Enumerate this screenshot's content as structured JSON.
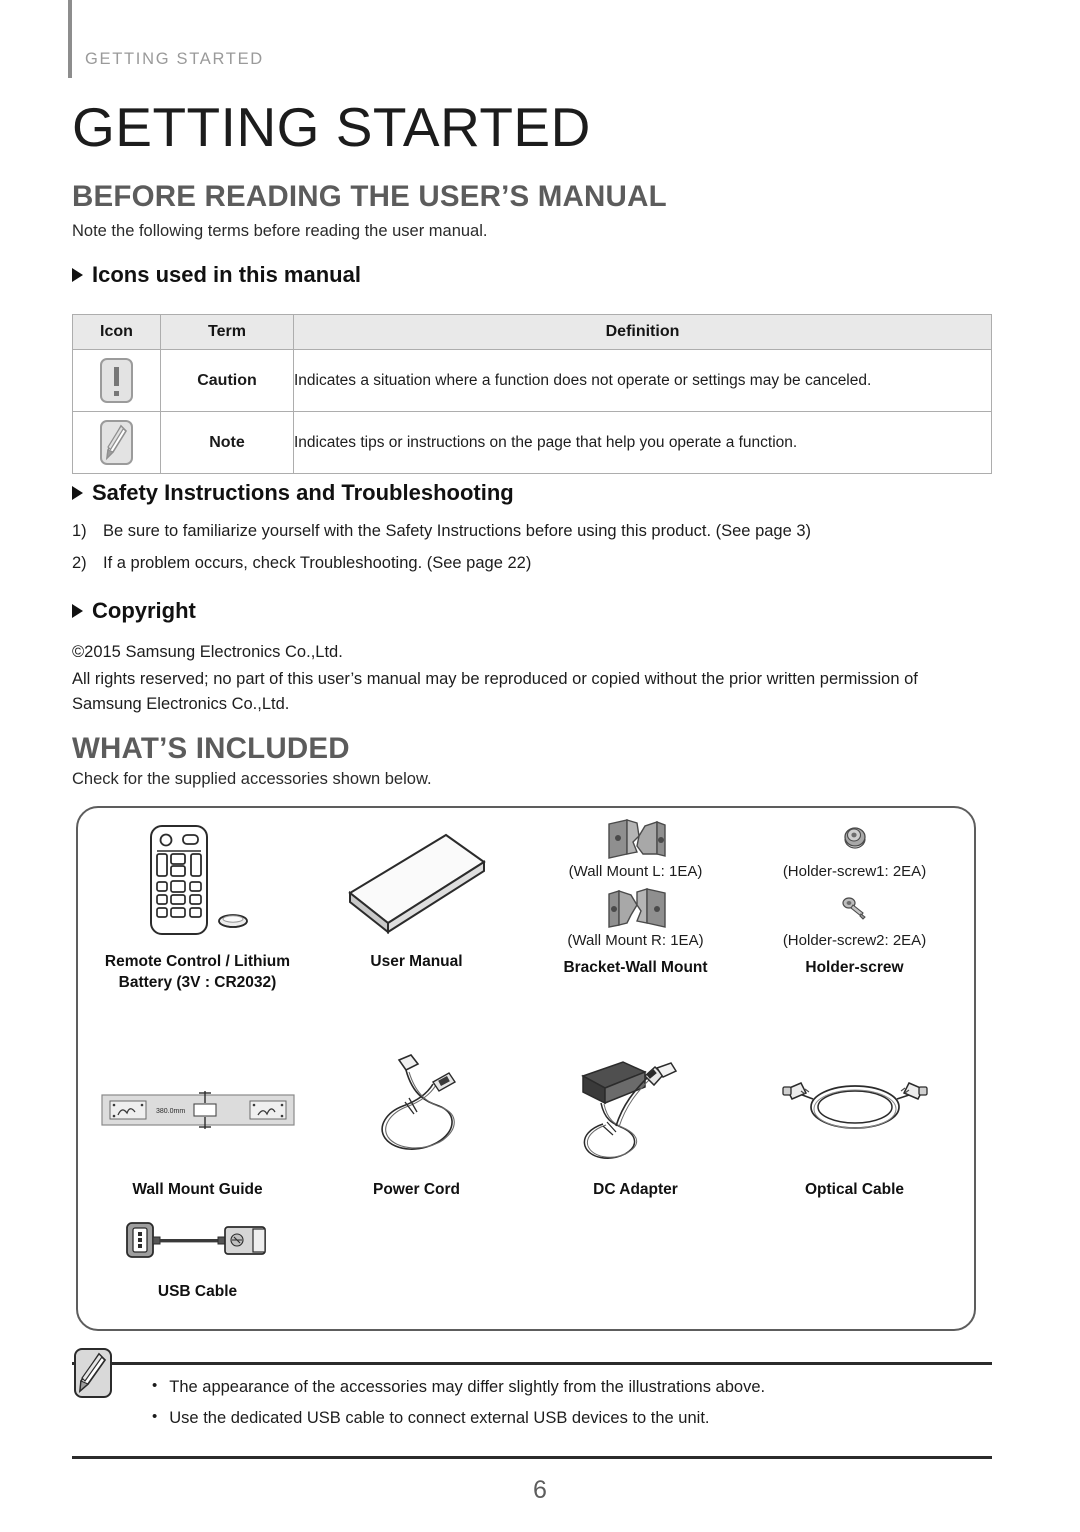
{
  "running_head": "GETTING STARTED",
  "chapter_title": "GETTING STARTED",
  "sections": {
    "before": {
      "heading": "BEFORE READING THE USER’S MANUAL",
      "intro": "Note the following terms before reading the user manual."
    },
    "included": {
      "heading": "WHAT’S INCLUDED",
      "intro": "Check for the supplied accessories shown below."
    }
  },
  "subheads": {
    "icons": "Icons used in this manual",
    "safety": "Safety Instructions and Troubleshooting",
    "copyright": "Copyright"
  },
  "icon_table": {
    "headers": [
      "Icon",
      "Term",
      "Definition"
    ],
    "rows": [
      {
        "icon_name": "caution-icon",
        "term": "Caution",
        "definition": "Indicates a situation where a function does not operate or settings may be canceled."
      },
      {
        "icon_name": "note-icon",
        "term": "Note",
        "definition": "Indicates tips or instructions on the page that help you operate a function."
      }
    ]
  },
  "safety_list": [
    {
      "num": "1)",
      "text": "Be sure to familiarize yourself with the Safety Instructions before using this product. (See page 3)"
    },
    {
      "num": "2)",
      "text": "If a problem occurs, check Troubleshooting. (See page 22)"
    }
  ],
  "copyright": {
    "line1": "©2015 Samsung Electronics Co.,Ltd.",
    "line2": "All rights reserved; no part of this user’s manual may be reproduced or copied without the prior written permission of Samsung Electronics Co.,Ltd."
  },
  "accessories": {
    "row1": [
      {
        "label": "Remote Control / Lithium Battery (3V : CR2032)",
        "art": "remote-control"
      },
      {
        "label": "User Manual",
        "art": "user-manual"
      },
      {
        "label": "Bracket-Wall Mount",
        "art": "wall-mount-brackets",
        "sub_items": [
          {
            "caption": "(Wall Mount L: 1EA)",
            "art": "wall-mount-left"
          },
          {
            "caption": "(Wall Mount R: 1EA)",
            "art": "wall-mount-right"
          }
        ]
      },
      {
        "label": "Holder-screw",
        "art": "holder-screws",
        "sub_items": [
          {
            "caption": "(Holder-screw1: 2EA)",
            "art": "holder-screw-1"
          },
          {
            "caption": "(Holder-screw2: 2EA)",
            "art": "holder-screw-2"
          }
        ]
      }
    ],
    "row2": [
      {
        "label": "Wall Mount Guide",
        "art": "wall-mount-guide",
        "dimension": "380.0mm"
      },
      {
        "label": "Power Cord",
        "art": "power-cord"
      },
      {
        "label": "DC Adapter",
        "art": "dc-adapter"
      },
      {
        "label": "Optical Cable",
        "art": "optical-cable"
      }
    ],
    "row3": [
      {
        "label": "USB Cable",
        "art": "usb-cable"
      }
    ]
  },
  "note_callout": {
    "icon_name": "note-icon",
    "items": [
      "The appearance of the accessories may differ slightly from the illustrations above.",
      "Use the dedicated USB cable to connect external USB devices to the unit."
    ]
  },
  "page_number": "6",
  "colors": {
    "heading_grey": "#5c5c5c",
    "running_head_grey": "#9a9a9a",
    "table_header_fill": "#e9e9e9",
    "box_border": "#5d5d5d",
    "rule": "#2b2b2b"
  }
}
